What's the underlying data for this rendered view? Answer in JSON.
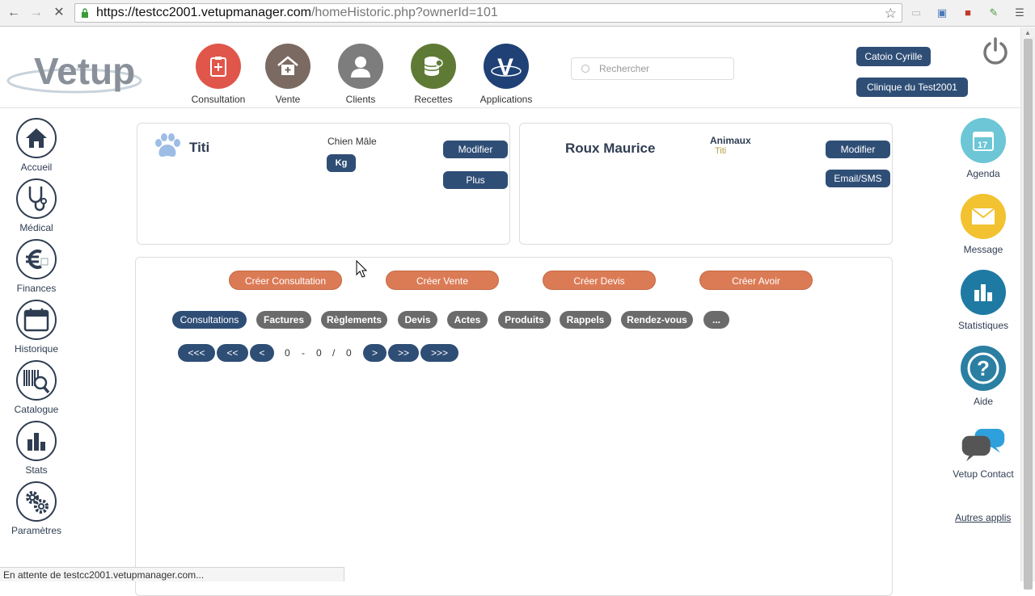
{
  "browser": {
    "url_host": "https://testcc2001.vetupmanager.com",
    "url_path": "/homeHistoric.php?ownerId=101",
    "status_text": "En attente de testcc2001.vetupmanager.com..."
  },
  "header": {
    "logo_text": "Vetup",
    "nav": [
      {
        "label": "Consultation",
        "color": "#e0564a",
        "icon": "clipboard-icon"
      },
      {
        "label": "Vente",
        "color": "#7b6a62",
        "icon": "shop-icon"
      },
      {
        "label": "Clients",
        "color": "#7d7d7d",
        "icon": "user-icon"
      },
      {
        "label": "Recettes",
        "color": "#5f7a35",
        "icon": "coins-icon"
      },
      {
        "label": "Applications",
        "color": "#1f4175",
        "icon": "vetup-v-icon"
      }
    ],
    "search_placeholder": "Rechercher",
    "user_name": "Catoio Cyrille",
    "clinic_name": "Clinique du Test2001"
  },
  "left_nav": [
    {
      "label": "Accueil",
      "icon": "home-icon"
    },
    {
      "label": "Médical",
      "icon": "stethoscope-icon"
    },
    {
      "label": "Finances",
      "icon": "euro-icon"
    },
    {
      "label": "Historique",
      "icon": "calendar-icon"
    },
    {
      "label": "Catalogue",
      "icon": "barcode-icon"
    },
    {
      "label": "Stats",
      "icon": "bar-chart-icon"
    },
    {
      "label": "Paramètres",
      "icon": "gears-icon"
    }
  ],
  "right_nav": [
    {
      "label": "Agenda",
      "color": "#6cc6d6",
      "icon": "calendar-17-icon"
    },
    {
      "label": "Message",
      "color": "#f2c230",
      "icon": "envelope-icon"
    },
    {
      "label": "Statistiques",
      "color": "#1f7aa3",
      "icon": "bar-chart-icon"
    },
    {
      "label": "Aide",
      "color": "#2a7fa3",
      "icon": "help-icon"
    },
    {
      "label": "Vetup Contact",
      "icon": "chat-bubbles-icon"
    }
  ],
  "other_apps": "Autres applis",
  "animal": {
    "name": "Titi",
    "species": "Chien Mâle",
    "weight_unit": "Kg",
    "modify": "Modifier",
    "more": "Plus"
  },
  "owner": {
    "name": "Roux Maurice",
    "animals_label": "Animaux",
    "animal_name": "Titi",
    "modify": "Modifier",
    "email_sms": "Email/SMS"
  },
  "actions": [
    "Créer Consultation",
    "Créer Vente",
    "Créer Devis",
    "Créer Avoir"
  ],
  "tabs": [
    "Consultations",
    "Factures",
    "Règlements",
    "Devis",
    "Actes",
    "Produits",
    "Rappels",
    "Rendez-vous",
    "..."
  ],
  "pager": {
    "first": "<<<",
    "prev_big": "<<",
    "prev": "<",
    "from": "0",
    "dash": "-",
    "to": "0",
    "slash": "/",
    "total": "0",
    "next": ">",
    "next_big": ">>",
    "last": ">>>"
  }
}
